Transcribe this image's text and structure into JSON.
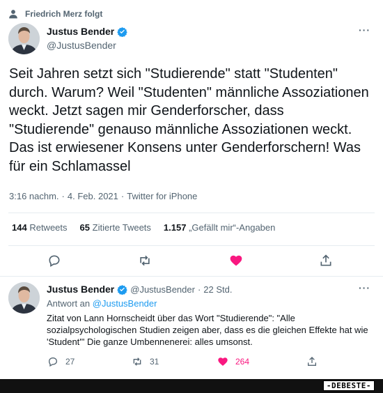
{
  "social_context": {
    "text": "Friedrich Merz folgt",
    "icon": "person-icon"
  },
  "main_tweet": {
    "display_name": "Justus Bender",
    "handle": "@JustusBender",
    "verified": true,
    "text": "Seit Jahren setzt sich \"Studierende\" statt \"Studenten\" durch. Warum? Weil \"Studenten\" männliche Assoziationen weckt. Jetzt sagen mir Genderforscher, dass \"Studierende\" genauso männliche Assoziationen weckt. Das ist erwiesener Konsens unter Genderforschern! Was für ein Schlamassel",
    "time": "3:16 nachm.",
    "date": "4. Feb. 2021",
    "source": "Twitter for iPhone",
    "stats": {
      "retweets_count": "144",
      "retweets_label": "Retweets",
      "quotes_count": "65",
      "quotes_label": "Zitierte Tweets",
      "likes_count": "1.157",
      "likes_label": "„Gefällt mir“-Angaben"
    },
    "more": "···"
  },
  "reply_tweet": {
    "display_name": "Justus Bender",
    "handle": "@JustusBender",
    "separator": "·",
    "time": "22 Std.",
    "replying_prefix": "Antwort an",
    "replying_to": "@JustusBender",
    "text": "Zitat von Lann Hornscheidt über das Wort \"Studierende\": \"Alle sozialpsychologischen Studien zeigen aber, dass es die gleichen Effekte hat wie 'Student'\" Die ganze Umbennenerei: alles umsonst.",
    "reply_count": "27",
    "retweet_count": "31",
    "like_count": "264",
    "more": "···"
  },
  "watermark": "-DEBESTE-",
  "colors": {
    "accent": "#1d9bf0",
    "like": "#f91880",
    "muted": "#536471"
  }
}
